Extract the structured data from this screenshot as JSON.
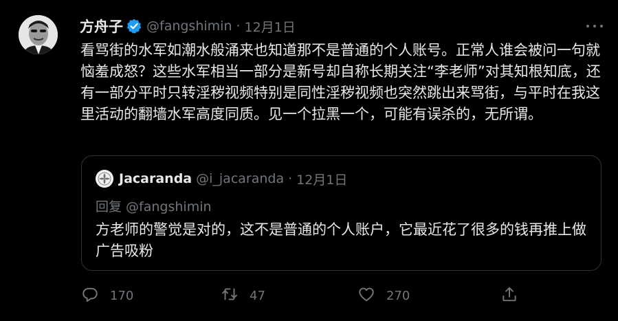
{
  "tweet": {
    "author_name": "方舟子",
    "author_handle": "@fangshimin",
    "separator": "·",
    "date": "12月1日",
    "text": "看骂街的水军如潮水般涌来也知道那不是普通的个人账号。正常人谁会被问一句就恼羞成怒？这些水军相当一部分是新号却自称长期关注“李老师”对其知根知底，还有一部分平时只转淫秽视频特别是同性淫秽视频也突然跳出来骂街，与平时在我这里活动的翻墙水军高度同质。见一个拉黑一个，可能有误杀的，无所谓。"
  },
  "quote": {
    "author_name": "Jacaranda",
    "author_handle": "@i_jacaranda",
    "separator": "·",
    "date": "12月1日",
    "reply_to": "回复 @fangshimin",
    "text": "方老师的警觉是对的，这不是普通的个人账户，它最近花了很多的钱再推上做广告吸粉"
  },
  "actions": {
    "reply_count": "170",
    "retweet_count": "47",
    "like_count": "270"
  },
  "icons": {
    "verified": "verified-badge-icon",
    "more": "more-icon",
    "reply": "reply-icon",
    "retweet": "retweet-icon",
    "like": "like-icon",
    "share": "share-icon"
  },
  "colors": {
    "background": "#000000",
    "text": "#e7e9ea",
    "secondary": "#71767b",
    "verified": "#1d9bf0",
    "border": "#2f3336"
  }
}
